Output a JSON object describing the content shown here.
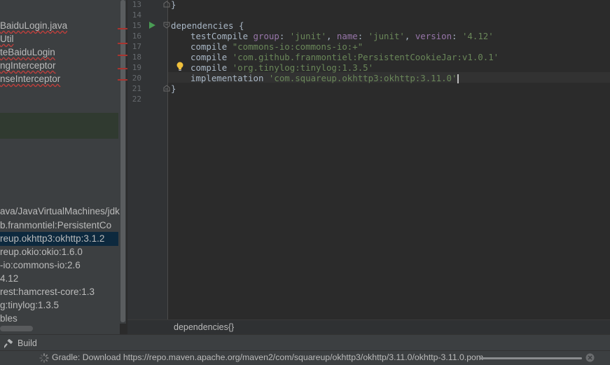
{
  "project_tree": {
    "items": [
      {
        "label": "BaiduLogin.java",
        "error": true
      },
      {
        "label": "Util",
        "error": true
      },
      {
        "label": "teBaiduLogin",
        "error": true
      },
      {
        "label": "ngInterceptor",
        "error": true
      },
      {
        "label": "nseInterceptor",
        "error": true
      }
    ],
    "libraries": [
      {
        "label": "ava/JavaVirtualMachines/jdk"
      },
      {
        "label": "b.franmontiel:PersistentCo"
      },
      {
        "label": "reup.okhttp3:okhttp:3.1.2",
        "selected": true
      },
      {
        "label": "reup.okio:okio:1.6.0"
      },
      {
        "label": "-io:commons-io:2.6"
      },
      {
        "label": "4.12"
      },
      {
        "label": "rest:hamcrest-core:1.3"
      },
      {
        "label": "g:tinylog:1.3.5"
      },
      {
        "label": "bles"
      }
    ]
  },
  "editor": {
    "line_numbers": [
      "13",
      "14",
      "15",
      "16",
      "17",
      "18",
      "19",
      "20",
      "21",
      "22"
    ],
    "lines": {
      "l13": {
        "close": "}"
      },
      "l15": {
        "text": "dependencies {"
      },
      "l16": {
        "fn": "testCompile ",
        "k1": "group",
        "s1": "'junit'",
        "k2": "name",
        "s2": "'junit'",
        "k3": "version",
        "s3": "'4.12'",
        "colon": ": ",
        "comma": ", "
      },
      "l17": {
        "fn": "compile ",
        "str": "\"commons-io:commons-io:+\""
      },
      "l18": {
        "fn": "compile ",
        "str": "'com.github.franmontiel:PersistentCookieJar:v1.0.1'"
      },
      "l19": {
        "fn": "compile ",
        "str": "'org.tinylog:tinylog:1.3.5'"
      },
      "l20": {
        "fn": "implementation ",
        "str": "'com.squareup.okhttp3:okhttp:3.11.0'"
      },
      "l21": {
        "close": "}"
      }
    },
    "breadcrumb": "dependencies{}"
  },
  "toolwindow": {
    "build_label": "Build"
  },
  "status": {
    "text": "Gradle: Download https://repo.maven.apache.org/maven2/com/squareup/okhttp3/okhttp/3.11.0/okhttp-3.11.0.pom",
    "progress": 1.0
  },
  "colors": {
    "string": "#6a8759",
    "keyword_arg": "#9876aa",
    "text": "#a9b7c6",
    "run_icon": "#499c54",
    "bulb_icon": "#f0c03c"
  }
}
